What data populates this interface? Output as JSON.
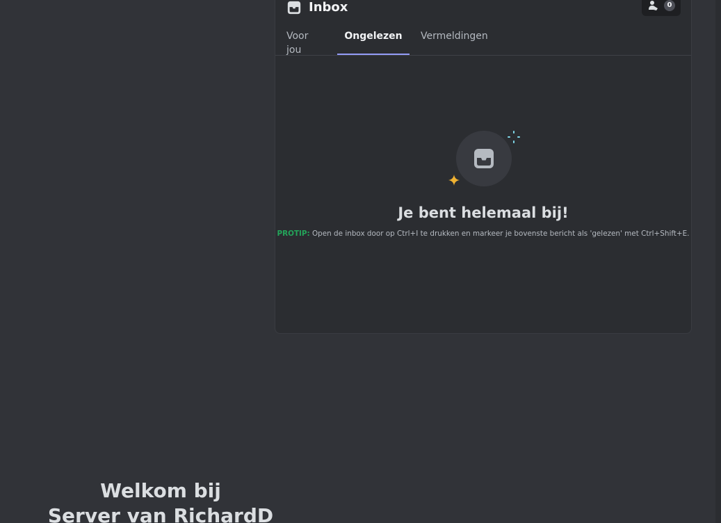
{
  "welcome": {
    "line1": "Welkom bij",
    "line2": "Server van RichardD"
  },
  "inbox": {
    "title": "Inbox",
    "header_badge_count": "0",
    "tabs": [
      {
        "label": "Voor jou",
        "active": false
      },
      {
        "label": "Ongelezen",
        "active": true
      },
      {
        "label": "Vermeldingen",
        "active": false
      }
    ],
    "empty": {
      "title": "Je bent helemaal bij!",
      "protip_label": "PROTIP:",
      "protip_text": " Open de inbox door op Ctrl+I te drukken en markeer je bovenste bericht als 'gelezen' met Ctrl+Shift+E."
    }
  },
  "icons": {
    "inbox": "inbox-icon",
    "person": "person-icon",
    "tray": "tray-icon",
    "star": "star-icon",
    "sparkle": "sparkle-icon"
  },
  "colors": {
    "background": "#313338",
    "panel": "#2b2d31",
    "tab_indicator": "#949cf7",
    "protip_green": "#23a55a",
    "star_yellow": "#f0b232",
    "sparkle_cyan": "#80d9ea"
  }
}
